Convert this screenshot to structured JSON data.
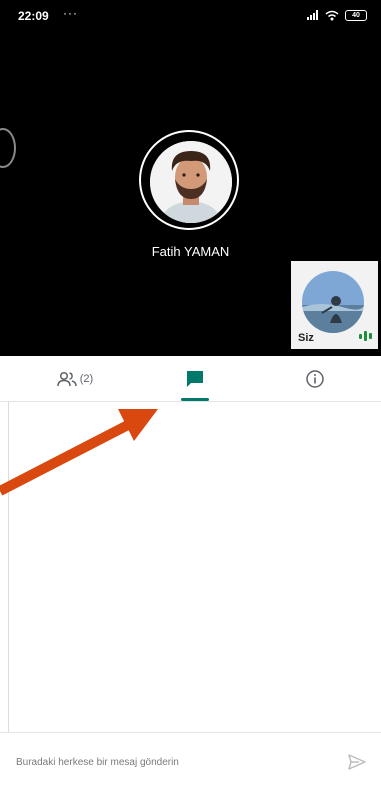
{
  "status_bar": {
    "time": "22:09",
    "dots": "···",
    "battery": "40"
  },
  "call": {
    "caller_name": "Fatih YAMAN",
    "self_label": "Siz"
  },
  "tabs": {
    "people_count": "(2)",
    "active": "chat",
    "icons": [
      "people-icon",
      "chat-icon",
      "info-icon"
    ]
  },
  "composer": {
    "placeholder": "Buradaki herkese bir mesaj gönderin",
    "value": ""
  },
  "colors": {
    "accent": "#00796b",
    "video_bg": "#000000",
    "annotation_arrow": "#d9480f",
    "speaking_indicator": "#1e8e3e"
  }
}
